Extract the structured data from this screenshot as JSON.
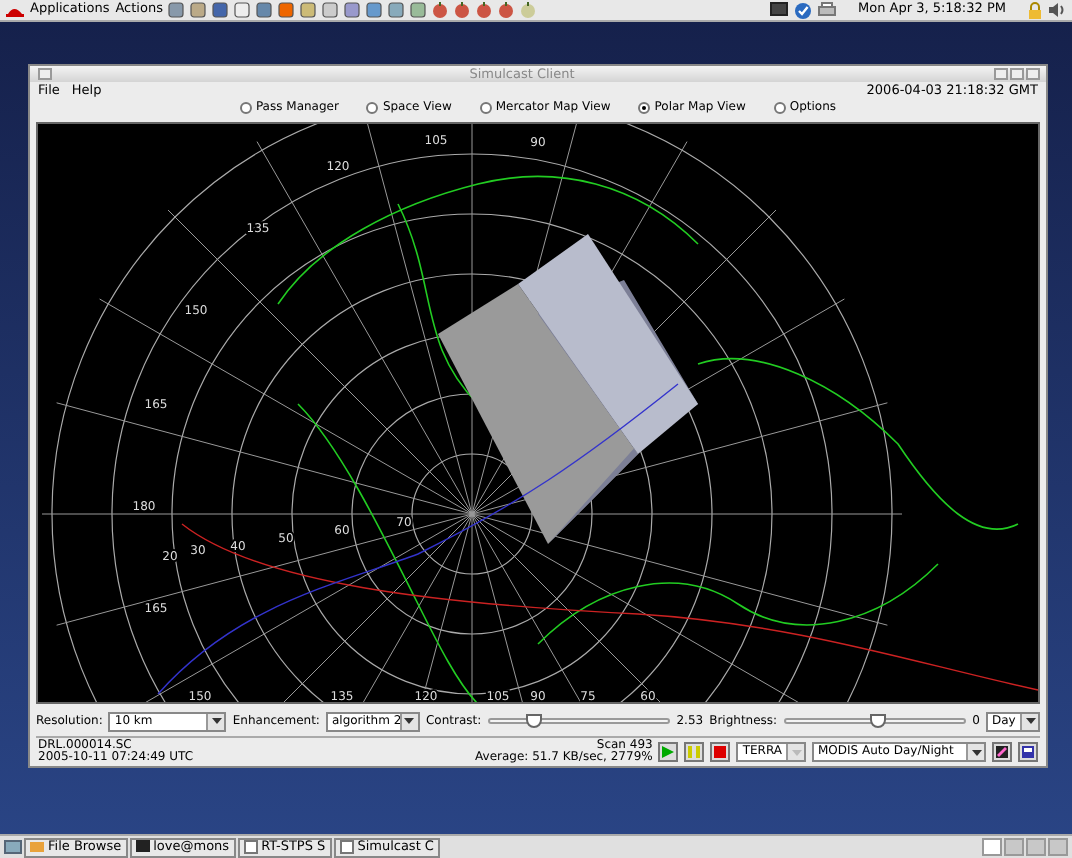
{
  "top_panel": {
    "menus": [
      "Applications",
      "Actions"
    ],
    "clock": "Mon Apr  3,  5:18:32 PM"
  },
  "window": {
    "title": "Simulcast Client",
    "menu": [
      "File",
      "Help"
    ],
    "timestamp": "2006-04-03 21:18:32 GMT",
    "views": [
      {
        "label": "Pass Manager",
        "selected": false
      },
      {
        "label": "Space View",
        "selected": false
      },
      {
        "label": "Mercator Map View",
        "selected": false
      },
      {
        "label": "Polar Map View",
        "selected": true
      },
      {
        "label": "Options",
        "selected": false
      }
    ],
    "map_labels": [
      "105",
      "120",
      "135",
      "150",
      "165",
      "90",
      "180",
      "165",
      "20",
      "30",
      "40",
      "50",
      "60",
      "70",
      "150",
      "135",
      "120",
      "105",
      "90",
      "75",
      "60"
    ],
    "controls": {
      "resolution_label": "Resolution:",
      "resolution": "10 km",
      "enhancement_label": "Enhancement:",
      "enhancement": "algorithm 2",
      "contrast_label": "Contrast:",
      "contrast": {
        "level": 0.25,
        "reading": "2.53"
      },
      "brightness_label": "Brightness:",
      "brightness": {
        "level": 0.52,
        "reading": "0"
      },
      "mode": "Day"
    },
    "status": {
      "file": "DRL.000014.SC",
      "time": "2005-10-11 07:24:49 UTC",
      "scan": "Scan 493",
      "average": "Average: 51.7 KB/sec, 2779%",
      "satellite": "TERRA",
      "product": "MODIS Auto Day/Night"
    }
  },
  "taskbar": {
    "tasks": [
      "File Browse",
      "love@mons",
      "RT-STPS S",
      "Simulcast C"
    ],
    "workspaces": [
      {
        "selected": true
      },
      {
        "selected": false
      },
      {
        "selected": false
      },
      {
        "selected": false
      }
    ]
  }
}
